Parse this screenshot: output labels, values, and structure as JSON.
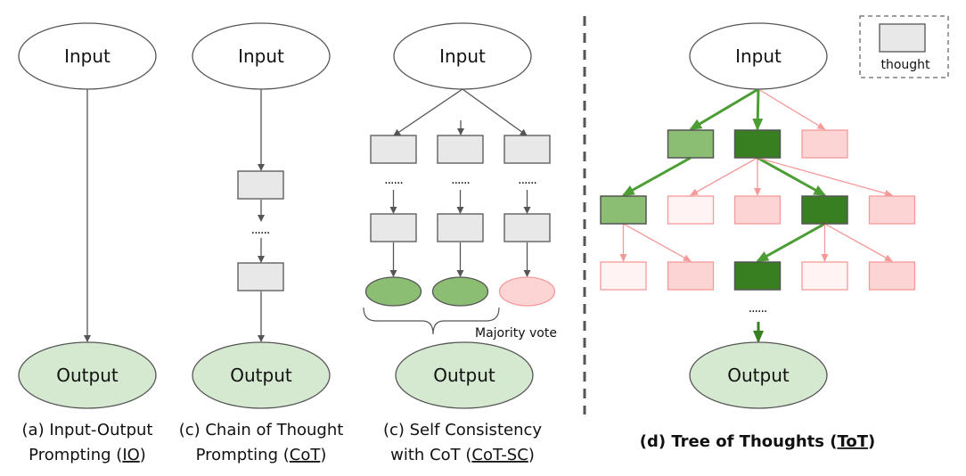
{
  "colors": {
    "edge_gray": "#555555",
    "thought_gray": "#e8e8e8",
    "output_green": "#d5e8d0",
    "good_green": "#8bbd73",
    "best_green": "#387f22",
    "arrow_green": "#4c9e34",
    "bad_pink": "#fdd4d4",
    "bad_light": "#fff3f3",
    "bad_border": "#f49a9a",
    "bad_edge": "#f49a9a"
  },
  "panels": {
    "io": {
      "input_label": "Input",
      "output_label": "Output",
      "caption_line1": "(a) Input-Output",
      "caption_line2_pre": "Prompting (",
      "caption_line2_abbr": "IO",
      "caption_line2_post": ")"
    },
    "cot": {
      "input_label": "Input",
      "output_label": "Output",
      "ellipsis": "......",
      "caption_line1": "(c) Chain of Thought",
      "caption_line2_pre": "Prompting (",
      "caption_line2_abbr": "CoT",
      "caption_line2_post": ")"
    },
    "cot_sc": {
      "input_label": "Input",
      "output_label": "Output",
      "ellipsis": "......",
      "vote_label": "Majority vote",
      "caption_line1": "(c) Self Consistency",
      "caption_line2_pre": "with CoT (",
      "caption_line2_abbr": "CoT-SC",
      "caption_line2_post": ")",
      "answers": [
        "good",
        "good",
        "bad"
      ]
    },
    "tot": {
      "input_label": "Input",
      "output_label": "Output",
      "ellipsis": "......",
      "caption_pre": "(d) Tree of Thoughts (",
      "caption_abbr": "ToT",
      "caption_post": ")",
      "rows": [
        {
          "cols": [
            1,
            2,
            3
          ],
          "states": [
            "good",
            "best",
            "bad"
          ]
        },
        {
          "cols": [
            0,
            1,
            2,
            3,
            4
          ],
          "states": [
            "good",
            "bad-light",
            "bad",
            "best",
            "bad"
          ]
        },
        {
          "cols": [
            0,
            1,
            2,
            3,
            4
          ],
          "states": [
            "bad-light",
            "bad",
            "best",
            "bad-light",
            "bad"
          ]
        }
      ],
      "edges": [
        {
          "from": "input",
          "to": [
            0,
            0
          ],
          "type": "good"
        },
        {
          "from": "input",
          "to": [
            0,
            1
          ],
          "type": "good"
        },
        {
          "from": "input",
          "to": [
            0,
            2
          ],
          "type": "bad"
        },
        {
          "from": [
            0,
            0
          ],
          "to": [
            1,
            0
          ],
          "type": "good"
        },
        {
          "from": [
            0,
            1
          ],
          "to": [
            1,
            1
          ],
          "type": "bad"
        },
        {
          "from": [
            0,
            1
          ],
          "to": [
            1,
            2
          ],
          "type": "bad"
        },
        {
          "from": [
            0,
            1
          ],
          "to": [
            1,
            3
          ],
          "type": "good"
        },
        {
          "from": [
            0,
            1
          ],
          "to": [
            1,
            4
          ],
          "type": "bad"
        },
        {
          "from": [
            1,
            0
          ],
          "to": [
            2,
            0
          ],
          "type": "bad"
        },
        {
          "from": [
            1,
            0
          ],
          "to": [
            2,
            1
          ],
          "type": "bad"
        },
        {
          "from": [
            1,
            3
          ],
          "to": [
            2,
            2
          ],
          "type": "good"
        },
        {
          "from": [
            1,
            3
          ],
          "to": [
            2,
            3
          ],
          "type": "bad"
        },
        {
          "from": [
            1,
            3
          ],
          "to": [
            2,
            4
          ],
          "type": "bad"
        }
      ]
    }
  },
  "legend": {
    "label": "thought"
  }
}
